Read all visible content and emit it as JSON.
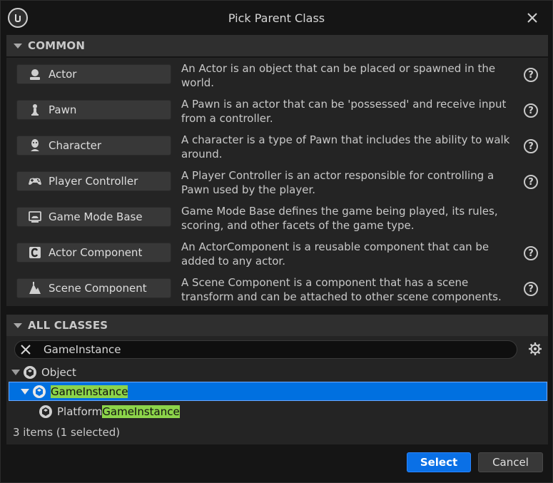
{
  "window": {
    "title": "Pick Parent Class"
  },
  "common": {
    "header": "COMMON",
    "items": [
      {
        "label": "Actor",
        "icon": "actor-icon",
        "description": "An Actor is an object that can be placed or spawned in the world.",
        "has_help": true
      },
      {
        "label": "Pawn",
        "icon": "pawn-icon",
        "description": "A Pawn is an actor that can be 'possessed' and receive input from a controller.",
        "has_help": true
      },
      {
        "label": "Character",
        "icon": "character-icon",
        "description": "A character is a type of Pawn that includes the ability to walk around.",
        "has_help": true
      },
      {
        "label": "Player Controller",
        "icon": "gamepad-icon",
        "description": "A Player Controller is an actor responsible for controlling a Pawn used by the player.",
        "has_help": true
      },
      {
        "label": "Game Mode Base",
        "icon": "game-mode-icon",
        "description": "Game Mode Base defines the game being played, its rules, scoring, and other facets of the game type.",
        "has_help": false
      },
      {
        "label": "Actor Component",
        "icon": "actor-component-icon",
        "description": "An ActorComponent is a reusable component that can be added to any actor.",
        "has_help": true
      },
      {
        "label": "Scene Component",
        "icon": "scene-component-icon",
        "description": "A Scene Component is a component that has a scene transform and can be attached to other scene components.",
        "has_help": true
      }
    ]
  },
  "all_classes": {
    "header": "ALL CLASSES",
    "search_value": "GameInstance",
    "tree": [
      {
        "prefix": "",
        "match": "",
        "suffix": "Object",
        "selected": false
      },
      {
        "prefix": "",
        "match": "GameInstance",
        "suffix": "",
        "selected": true
      },
      {
        "prefix": "Platform",
        "match": "GameInstance",
        "suffix": "",
        "selected": false
      }
    ],
    "status": "3 items (1 selected)"
  },
  "footer": {
    "select_label": "Select",
    "cancel_label": "Cancel"
  },
  "colors": {
    "accent": "#0a70e6",
    "selection": "#0070e0",
    "highlight": "#8cd44a",
    "background": "#151515",
    "panel": "#242424"
  }
}
